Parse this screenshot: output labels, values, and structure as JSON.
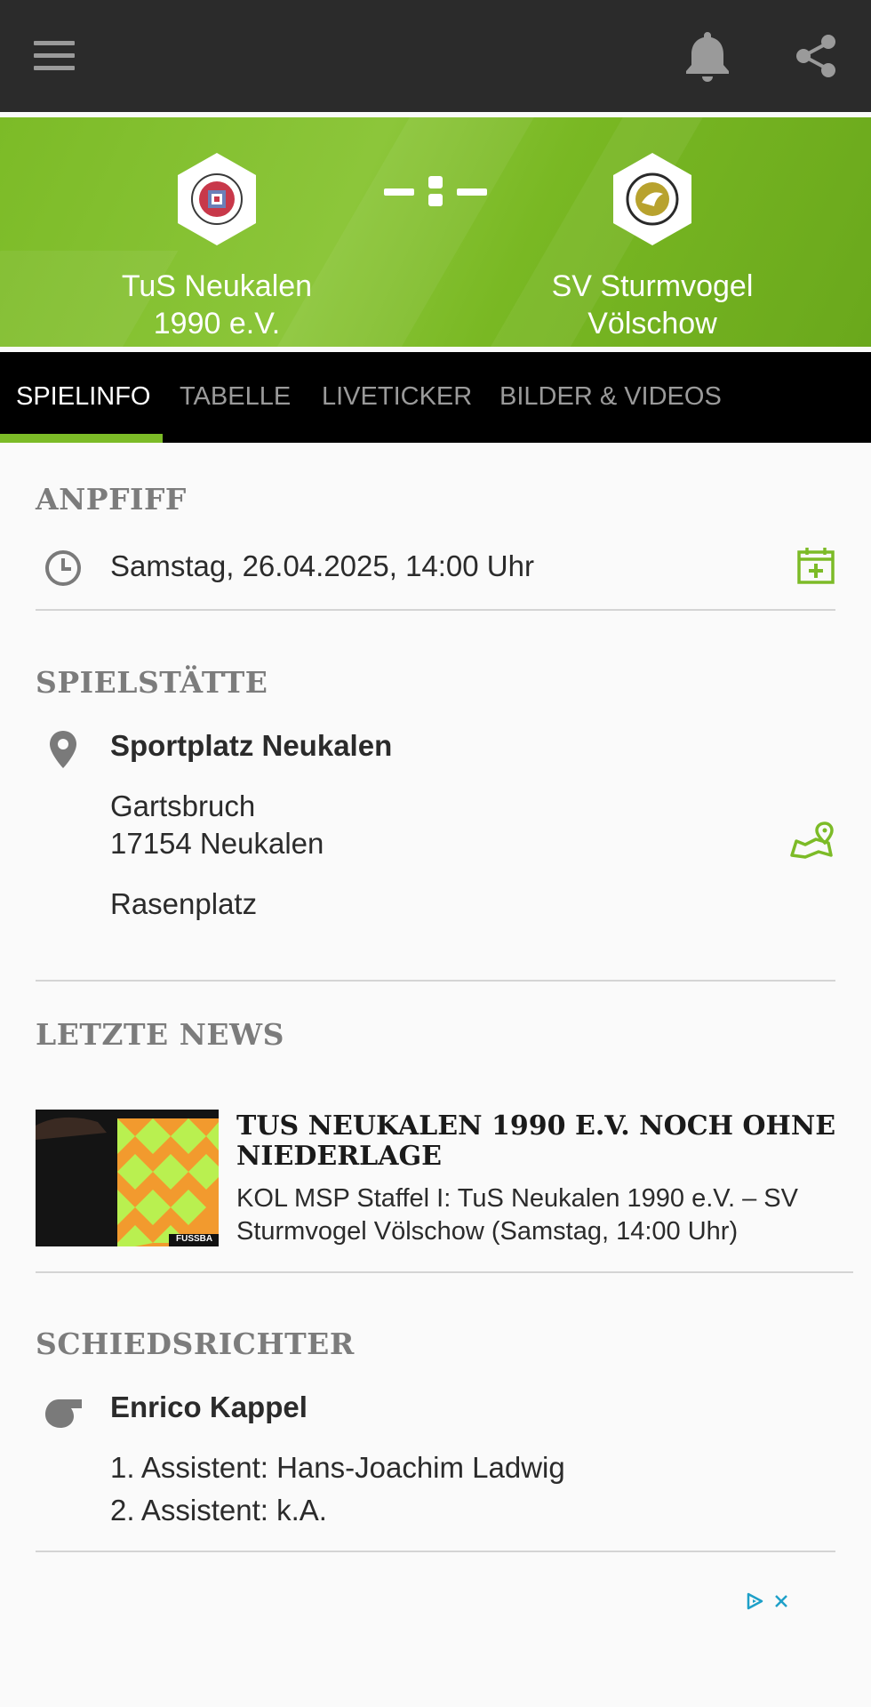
{
  "appbar": {
    "menu_icon": "hamburger-menu-icon",
    "bell_icon": "bell-icon",
    "share_icon": "share-icon"
  },
  "match": {
    "home_team_line1": "TuS Neukalen",
    "home_team_line2": "1990 e.V.",
    "away_team_line1": "SV Sturmvogel",
    "away_team_line2": "Völschow",
    "score_separator": "-:-",
    "colors": {
      "header_green": "#7cbb27",
      "accent": "#7cbb27"
    }
  },
  "tabs": [
    {
      "label": "SPIELINFO",
      "active": true
    },
    {
      "label": "TABELLE",
      "active": false
    },
    {
      "label": "LIVETICKER",
      "active": false
    },
    {
      "label": "BILDER & VIDEOS",
      "active": false
    }
  ],
  "anpfiff": {
    "title": "ANPFIFF",
    "datetime": "Samstag, 26.04.2025, 14:00 Uhr",
    "icon": "clock-icon",
    "action_icon": "add-to-calendar-icon"
  },
  "spielstaette": {
    "title": "SPIELSTÄTTE",
    "name": "Sportplatz Neukalen",
    "street": "Gartsbruch",
    "city": "17154 Neukalen",
    "surface": "Rasenplatz",
    "icon": "location-pin-icon",
    "action_icon": "map-icon"
  },
  "news": {
    "title": "LETZTE NEWS",
    "headline": "TUS NEUKALEN 1990 E.V. NOCH OHNE NIEDERLAGE",
    "teaser": "KOL MSP Staffel I: TuS Neukalen 1990 e.V. – SV Sturmvogel Völschow (Samstag, 14:00 Uhr)",
    "thumb_watermark": "FUSSBA"
  },
  "schiedsrichter": {
    "title": "SCHIEDSRICHTER",
    "name": "Enrico Kappel",
    "assistant1": "1. Assistent: Hans-Joachim Ladwig",
    "assistant2": "2. Assistent: k.A.",
    "icon": "whistle-icon"
  },
  "ad": {
    "icons": [
      "adchoices-icon",
      "close-icon"
    ]
  }
}
